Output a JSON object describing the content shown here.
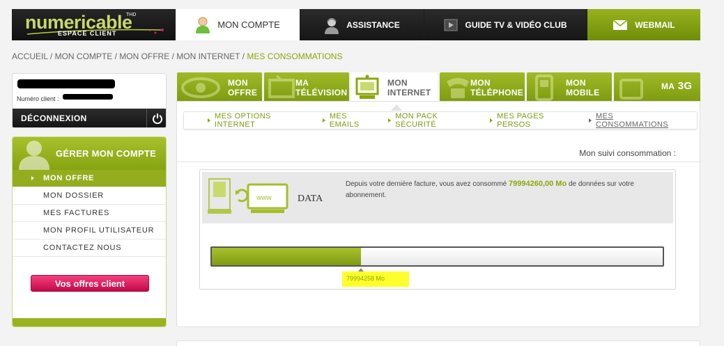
{
  "brand": {
    "name": "numericable",
    "sub": "ESPACE CLIENT",
    "thd": "THD"
  },
  "topnav": {
    "compte": "MON COMPTE",
    "assistance": "ASSISTANCE",
    "guide": "GUIDE TV & VIDÉO CLUB",
    "webmail": "WEBMAIL"
  },
  "breadcrumb": {
    "trail": "ACCUEIL / MON COMPTE / MON OFFRE / MON INTERNET / ",
    "current": "MES CONSOMMATIONS"
  },
  "account": {
    "client_label": "Numéro client :",
    "disconnect": "DÉCONNEXION"
  },
  "manage": {
    "title": "GÉRER MON COMPTE",
    "items": [
      "MON OFFRE",
      "MON DOSSIER",
      "MES FACTURES",
      "MON PROFIL UTILISATEUR",
      "CONTACTEZ NOUS"
    ],
    "offers_button": "Vos offres client"
  },
  "services": [
    {
      "l1": "MON",
      "l2": "OFFRE"
    },
    {
      "l1": "MA",
      "l2": "TÉLÉVISION"
    },
    {
      "l1": "MON",
      "l2": "INTERNET"
    },
    {
      "l1": "MON",
      "l2": "TÉLÉPHONE"
    },
    {
      "l1": "MON",
      "l2": "MOBILE"
    },
    {
      "l1": "MA",
      "l2": "3G"
    }
  ],
  "subnav": {
    "items": [
      "MES OPTIONS INTERNET",
      "MES EMAILS",
      "MON PACK SÉCURITÉ",
      "MES PAGES PERSOS",
      "MES CONSOMMATIONS"
    ]
  },
  "consumption": {
    "heading": "Mon suivi consommation :",
    "data_label": "DATA",
    "www": "www",
    "text_before": "Depuis votre dernière facture, vous avez consommé ",
    "amount": "79994260,00 Mo",
    "text_after": " de données sur votre abonnement.",
    "bar_fraction": 0.33,
    "bar_value": "79994258 Mo"
  },
  "colors": {
    "accent": "#8aa70d",
    "pink": "#e2155d",
    "highlight": "#ffff2b"
  }
}
